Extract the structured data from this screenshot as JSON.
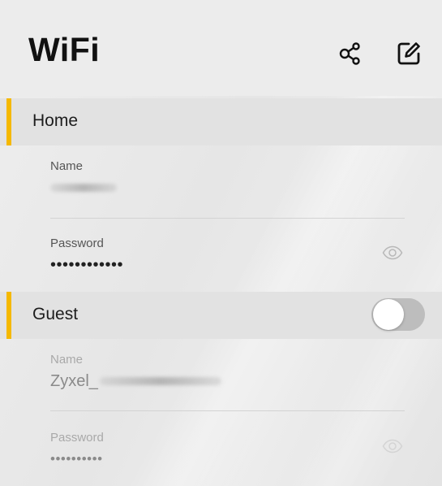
{
  "header": {
    "title": "WiFi",
    "share_icon": "share-icon",
    "edit_icon": "edit-icon"
  },
  "home": {
    "title": "Home",
    "name_label": "Name",
    "name_value": "",
    "name_obscured": true,
    "password_label": "Password",
    "password_value": "••••••••••••",
    "eye_icon": "eye-icon"
  },
  "guest": {
    "title": "Guest",
    "enabled": false,
    "name_label": "Name",
    "name_value": "Zyxel_",
    "name_obscured": true,
    "password_label": "Password",
    "password_value": "••••••••••",
    "eye_icon": "eye-icon"
  },
  "colors": {
    "accent": "#f5b800",
    "toggle_off": "#bdbdbd"
  }
}
